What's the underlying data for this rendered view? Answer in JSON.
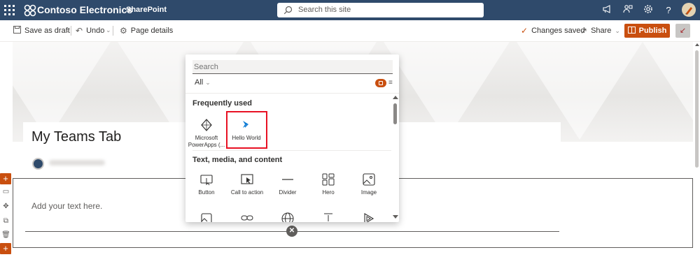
{
  "suite": {
    "brand": "Contoso Electronics",
    "app": "SharePoint",
    "search_placeholder": "Search this site",
    "icons": [
      "waffle-icon",
      "megaphone-icon",
      "community-icon",
      "gear-icon",
      "help-icon",
      "avatar"
    ]
  },
  "commandbar": {
    "save_draft": "Save as draft",
    "undo": "Undo",
    "page_details": "Page details",
    "changes_saved": "Changes saved",
    "share": "Share",
    "publish": "Publish"
  },
  "page": {
    "title": "My Teams Tab",
    "text_placeholder": "Add your text here."
  },
  "toolbox": {
    "search_placeholder": "Search",
    "filter": "All",
    "section_frequent": "Frequently used",
    "frequent_items": [
      {
        "label": "Microsoft PowerApps (...",
        "icon": "powerapps-icon"
      },
      {
        "label": "Hello World",
        "icon": "hello-world-icon"
      }
    ],
    "section_media": "Text, media, and content",
    "media_items": [
      {
        "label": "Button",
        "icon": "button-icon"
      },
      {
        "label": "Call to action",
        "icon": "call-to-action-icon"
      },
      {
        "label": "Divider",
        "icon": "divider-icon"
      },
      {
        "label": "Hero",
        "icon": "hero-icon"
      },
      {
        "label": "Image",
        "icon": "image-icon"
      }
    ],
    "more_row_icons": [
      "image-gallery-icon",
      "link-icon",
      "globe-icon",
      "spacer-icon",
      "stream-icon"
    ]
  },
  "colors": {
    "suitebar": "#2f4a6b",
    "accent": "#c94f0f",
    "highlight": "#e81123"
  }
}
